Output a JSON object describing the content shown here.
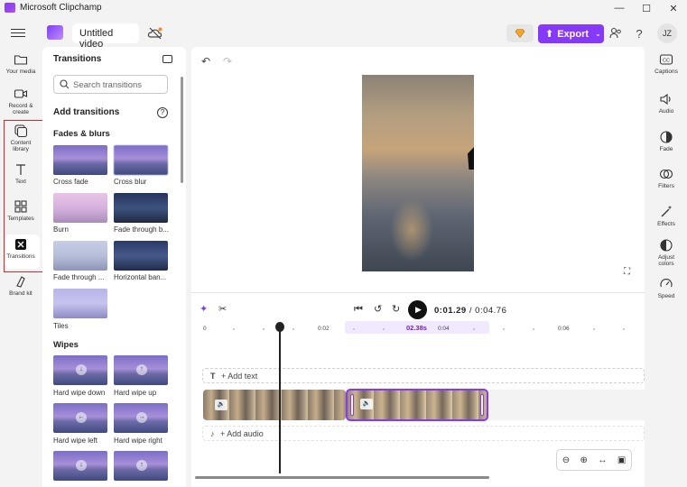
{
  "window": {
    "title": "Microsoft Clipchamp",
    "controls": [
      "—",
      "☐",
      "✕"
    ]
  },
  "toolbar": {
    "project_title": "Untitled video",
    "export_label": "Export",
    "avatar_initials": "JZ",
    "accent_color": "#8739f9"
  },
  "left_rail": {
    "items": [
      {
        "label": "Your media",
        "icon": "folder-icon"
      },
      {
        "label": "Record & create",
        "icon": "camera-icon"
      },
      {
        "label": "Content library",
        "icon": "library-icon"
      },
      {
        "label": "Text",
        "icon": "text-icon"
      },
      {
        "label": "Templates",
        "icon": "templates-icon"
      },
      {
        "label": "Transitions",
        "icon": "transitions-icon",
        "active": true
      },
      {
        "label": "Brand kit",
        "icon": "brand-kit-icon"
      }
    ],
    "highlight_color": "#e0242b"
  },
  "panel": {
    "title": "Transitions",
    "search_placeholder": "Search transitions",
    "add_heading": "Add transitions",
    "sections": [
      {
        "heading": "Fades & blurs",
        "items": [
          "Cross fade",
          "Cross blur",
          "Burn",
          "Fade through b...",
          "Fade through ...",
          "Horizontal ban...",
          "Tiles"
        ]
      },
      {
        "heading": "Wipes",
        "items": [
          "Hard wipe down",
          "Hard wipe up",
          "Hard wipe left",
          "Hard wipe right"
        ]
      }
    ]
  },
  "timeline": {
    "current_time": "0:01.29",
    "total_time": "0:04.76",
    "ruler": [
      "0",
      "0:02",
      "0:04",
      "0:06"
    ],
    "selection_label": "02.38s",
    "add_text": "+ Add text",
    "add_audio": "+ Add audio"
  },
  "right_rail": {
    "items": [
      {
        "label": "Captions",
        "icon": "captions-icon"
      },
      {
        "label": "Audio",
        "icon": "speaker-icon"
      },
      {
        "label": "Fade",
        "icon": "fade-icon"
      },
      {
        "label": "Filters",
        "icon": "filters-icon"
      },
      {
        "label": "Effects",
        "icon": "effects-icon"
      },
      {
        "label": "Adjust colors",
        "icon": "adjust-colors-icon"
      },
      {
        "label": "Speed",
        "icon": "speed-icon"
      }
    ]
  }
}
